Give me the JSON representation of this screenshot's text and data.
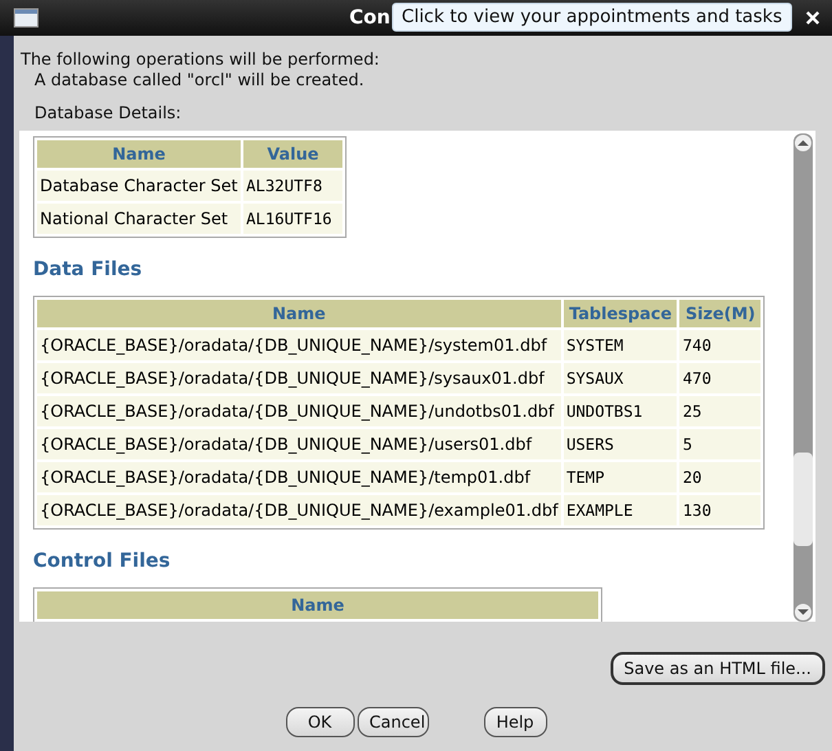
{
  "window": {
    "title": "Con"
  },
  "tooltip": "Click to view your appointments and tasks",
  "intro": [
    "The following operations will be performed:",
    "A database called \"orcl\" will be created."
  ],
  "details_label": "Database Details:",
  "details_table": {
    "columns": [
      "Name",
      "Value"
    ],
    "rows": [
      [
        "Database Character Set",
        "AL32UTF8"
      ],
      [
        "National Character Set",
        "AL16UTF16"
      ]
    ]
  },
  "data_files": {
    "heading": "Data Files",
    "columns": [
      "Name",
      "Tablespace",
      "Size(M)"
    ],
    "rows": [
      [
        "{ORACLE_BASE}/oradata/{DB_UNIQUE_NAME}/system01.dbf",
        "SYSTEM",
        "740"
      ],
      [
        "{ORACLE_BASE}/oradata/{DB_UNIQUE_NAME}/sysaux01.dbf",
        "SYSAUX",
        "470"
      ],
      [
        "{ORACLE_BASE}/oradata/{DB_UNIQUE_NAME}/undotbs01.dbf",
        "UNDOTBS1",
        "25"
      ],
      [
        "{ORACLE_BASE}/oradata/{DB_UNIQUE_NAME}/users01.dbf",
        "USERS",
        "5"
      ],
      [
        "{ORACLE_BASE}/oradata/{DB_UNIQUE_NAME}/temp01.dbf",
        "TEMP",
        "20"
      ],
      [
        "{ORACLE_BASE}/oradata/{DB_UNIQUE_NAME}/example01.dbf",
        "EXAMPLE",
        "130"
      ]
    ]
  },
  "control_files": {
    "heading": "Control Files",
    "columns": [
      "Name"
    ]
  },
  "save_button": "Save as an HTML file...",
  "buttons": [
    "OK",
    "Cancel",
    "Help"
  ]
}
